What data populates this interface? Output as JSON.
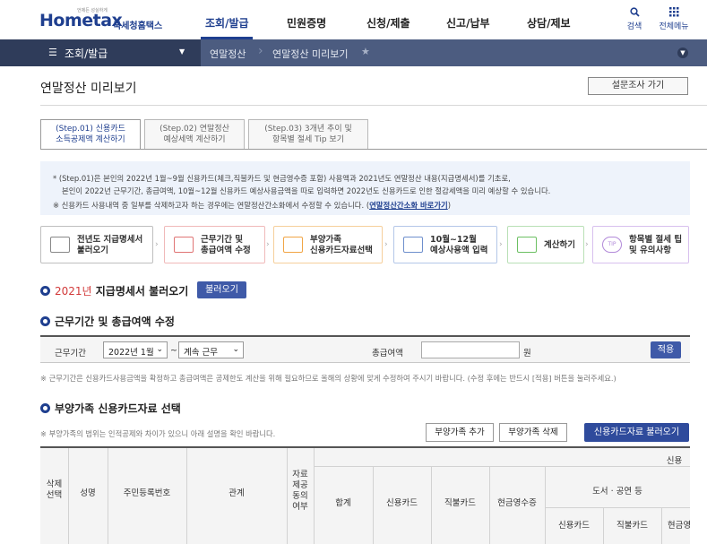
{
  "header": {
    "logo_text": "Hometax",
    "logo_site": "국세청홈택스",
    "logo_tagline": "언제든 성실하게",
    "nav": [
      "조회/발급",
      "민원증명",
      "신청/제출",
      "신고/납부",
      "상담/제보"
    ],
    "search_label": "검색",
    "menu_label": "전체메뉴"
  },
  "subbar": {
    "menu_selected": "조회/발급",
    "crumbs": [
      "연말정산",
      "연말정산 미리보기"
    ]
  },
  "page": {
    "title": "연말정산 미리보기",
    "survey_button": "설문조사 가기"
  },
  "steps": [
    {
      "line1": "(Step.01) 신용카드",
      "line2": "소득공제액 계산하기"
    },
    {
      "line1": "(Step.02) 연말정산",
      "line2": "예상세액 계산하기"
    },
    {
      "line1": "(Step.03) 3개년 추이 및",
      "line2": "항목별 절세 Tip 보기"
    }
  ],
  "info": {
    "line1": "* (Step.01)은 본인의 2022년 1월~9월 신용카드(체크,직불카드 및 현금영수증 포함) 사용액과 2021년도 연말정산 내용(지급명세서)를 기초로,",
    "line2": "본인이 2022년 근무기간, 총급여액, 10월~12월 신용카드 예상사용금액을 따로 입력하면 2022년도 신용카드로 인한 절감세액을 미리 예상할 수 있습니다.",
    "line3_prefix": "※ 신용카드 사용내역 중 일부를 삭제하고자 하는 경우에는 연말정산간소화에서 수정할 수 있습니다. (",
    "line3_link": "연말정산간소화 바로가기",
    "line3_suffix": ")"
  },
  "process": [
    {
      "line1": "전년도 지급명세서",
      "line2": "불러오기"
    },
    {
      "line1": "근무기간 및",
      "line2": "총급여액 수정"
    },
    {
      "line1": "부양가족",
      "line2": "신용카드자료선택"
    },
    {
      "line1": "10월~12월",
      "line2": "예상사용액 입력"
    },
    {
      "line1": "계산하기",
      "line2": ""
    },
    {
      "line1": "항목별 절세 팁",
      "line2": "및 유의사항",
      "icon_text": "TIP"
    }
  ],
  "section1": {
    "year": "2021년",
    "title": " 지급명세서 불러오기",
    "button": "불러오기"
  },
  "section2": {
    "title": "근무기간 및 총급여액 수정",
    "period_label": "근무기간",
    "period_value": "2022년 1월",
    "tilde": "~",
    "status_value": "계속 근무",
    "salary_label": "총급여액",
    "unit": "원",
    "apply_button": "적용",
    "note": "※ 근무기간은 신용카드사용금액을 확정하고 총급여액은 공제한도 계산을 위해 필요하므로 올해의 상황에 맞게 수정하여 주시기 바랍니다. (수정 후에는 반드시 [적용] 버튼을 눌러주세요.)"
  },
  "section3": {
    "title": "부양가족 신용카드자료 선택",
    "note": "※ 부양가족의 범위는 인적공제와 차이가 있으니 아래 설명을 확인 바랍니다.",
    "add_button": "부양가족 추가",
    "delete_button": "부양가족 삭제",
    "load_button": "신용카드자료 불러오기"
  },
  "table": {
    "col_select": [
      "삭제",
      "선택"
    ],
    "col_name": "성명",
    "col_rrn": "주민등록번호",
    "col_relation": "관계",
    "col_provide": [
      "자료",
      "제공",
      "동의",
      "여부"
    ],
    "col_total": "합계",
    "col_credit": "신용카드",
    "col_debit": "직불카드",
    "col_cash": "현금영수증",
    "group_top": "신용",
    "group_books": "도서 · 공연 등",
    "sub_credit": "신용카드",
    "sub_debit": "직불카드",
    "sub_cash": "현금영"
  }
}
